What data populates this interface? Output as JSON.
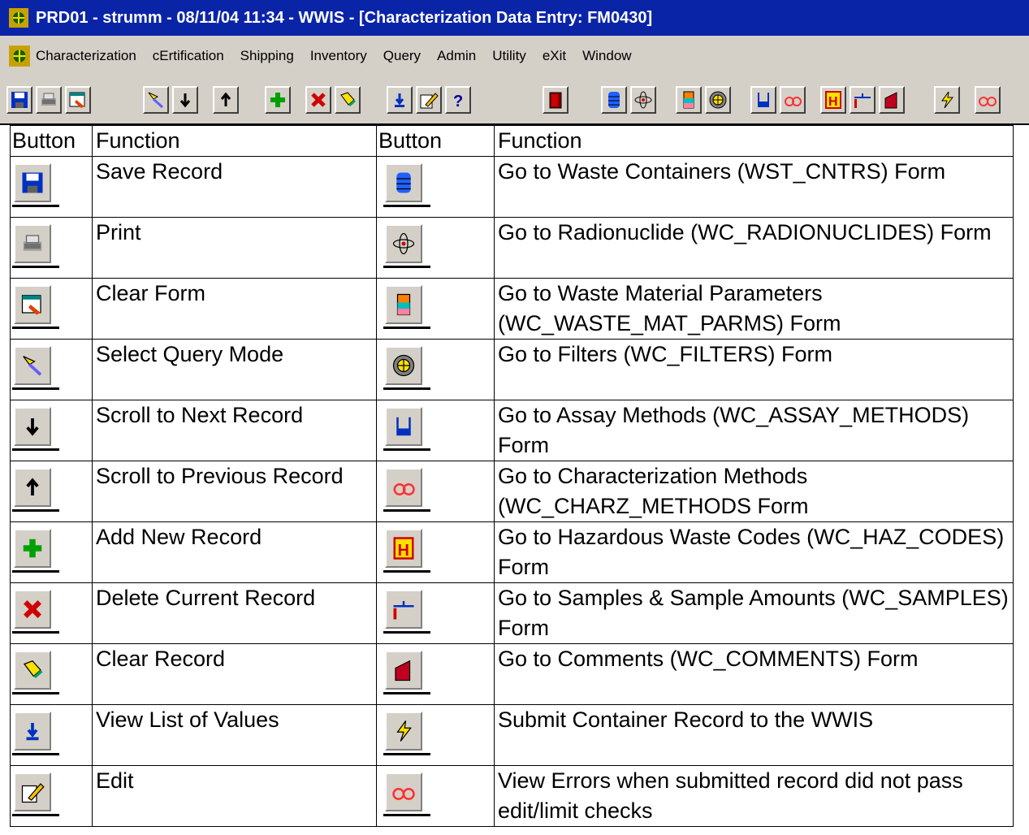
{
  "window": {
    "title": "PRD01 - strumm - 08/11/04 11:34 - WWIS - [Characterization Data Entry: FM0430]"
  },
  "menu": [
    "Characterization",
    "cErtification",
    "Shipping",
    "Inventory",
    "Query",
    "Admin",
    "Utility",
    "eXit",
    "Window"
  ],
  "toolbar": {
    "icons": [
      "save-icon",
      "print-icon",
      "clear-form-icon",
      "query-mode-icon",
      "arrow-down-icon",
      "arrow-up-icon",
      "add-record-icon",
      "delete-record-icon",
      "clear-record-icon",
      "list-of-values-icon",
      "edit-icon",
      "help-icon",
      "exit-door-icon",
      "waste-containers-icon",
      "radionuclide-icon",
      "waste-material-icon",
      "filters-icon",
      "assay-methods-icon",
      "charz-methods-icon",
      "haz-codes-icon",
      "samples-icon",
      "comments-icon",
      "submit-icon",
      "view-errors-icon"
    ]
  },
  "table": {
    "headers": [
      "Button",
      "Function",
      "Button",
      "Function"
    ],
    "rows": [
      {
        "left_icon": "save-icon",
        "left_function": "Save Record",
        "right_icon": "waste-containers-icon",
        "right_function": "Go to Waste Containers (WST_CNTRS) Form"
      },
      {
        "left_icon": "print-icon",
        "left_function": "Print",
        "right_icon": "radionuclide-icon",
        "right_function": "Go to Radionuclide (WC_RADIONUCLIDES) Form"
      },
      {
        "left_icon": "clear-form-icon",
        "left_function": "Clear Form",
        "right_icon": "waste-material-icon",
        "right_function": "Go to Waste Material Parameters (WC_WASTE_MAT_PARMS) Form"
      },
      {
        "left_icon": "query-mode-icon",
        "left_function": "Select Query Mode",
        "right_icon": "filters-icon",
        "right_function": "Go to Filters (WC_FILTERS) Form"
      },
      {
        "left_icon": "arrow-down-icon",
        "left_function": "Scroll to Next Record",
        "right_icon": "assay-methods-icon",
        "right_function": "Go to Assay Methods (WC_ASSAY_METHODS) Form"
      },
      {
        "left_icon": "arrow-up-icon",
        "left_function": "Scroll to Previous Record",
        "right_icon": "charz-methods-icon",
        "right_function": "Go to Characterization Methods (WC_CHARZ_METHODS Form"
      },
      {
        "left_icon": "add-record-icon",
        "left_function": "Add New Record",
        "right_icon": "haz-codes-icon",
        "right_function": "Go to Hazardous Waste Codes (WC_HAZ_CODES) Form"
      },
      {
        "left_icon": "delete-record-icon",
        "left_function": "Delete Current Record",
        "right_icon": "samples-icon",
        "right_function": "Go to Samples & Sample Amounts (WC_SAMPLES) Form"
      },
      {
        "left_icon": "clear-record-icon",
        "left_function": "Clear Record",
        "right_icon": "comments-icon",
        "right_function": "Go to Comments (WC_COMMENTS) Form"
      },
      {
        "left_icon": "list-of-values-icon",
        "left_function": "View List of Values",
        "right_icon": "submit-icon",
        "right_function": "Submit Container Record to the WWIS"
      },
      {
        "left_icon": "edit-icon",
        "left_function": "Edit",
        "right_icon": "view-errors-icon",
        "right_function": "View Errors when submitted record did not pass edit/limit checks"
      }
    ]
  },
  "colors": {
    "titlebar": "#0a24a8",
    "chrome": "#d4d0c8"
  }
}
